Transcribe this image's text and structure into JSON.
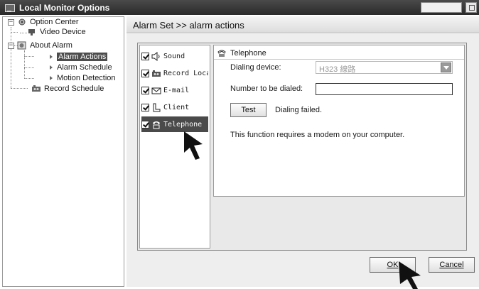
{
  "window": {
    "title": "Local Monitor Options"
  },
  "tree": {
    "root": "Option Center",
    "video_device": "Video Device",
    "about_alarm": "About Alarm",
    "alarm_actions": "Alarm Actions",
    "alarm_schedule": "Alarm Schedule",
    "motion_detection": "Motion Detection",
    "record_schedule": "Record Schedule",
    "root_expander": "−",
    "alarm_expander": "−"
  },
  "header": {
    "breadcrumb": "Alarm Set >> alarm actions"
  },
  "actions": {
    "sound": "Sound",
    "record": "Record Loca",
    "email": "E-mail",
    "client": "Client",
    "telephone": "Telephone"
  },
  "panel": {
    "title": "Telephone",
    "dialing_device_label": "Dialing device:",
    "dialing_device_value": "H323 線路",
    "number_label": "Number to be dialed:",
    "number_value": "",
    "test_button": "Test",
    "status": "Dialing failed.",
    "note": "This function requires a modem on your computer."
  },
  "footer": {
    "ok": "OK",
    "cancel": "Cancel"
  },
  "icons": {
    "app": "monitor-icon",
    "tree_root": "gear-icon",
    "video": "camera-icon",
    "alarm": "alarm-icon",
    "record": "recorder-icon",
    "sound": "speaker-icon",
    "email": "envelope-icon",
    "client": "client-icon",
    "telephone": "telephone-icon",
    "dropdown": "chevron-down-icon",
    "pointer": "mouse-pointer-icon"
  }
}
